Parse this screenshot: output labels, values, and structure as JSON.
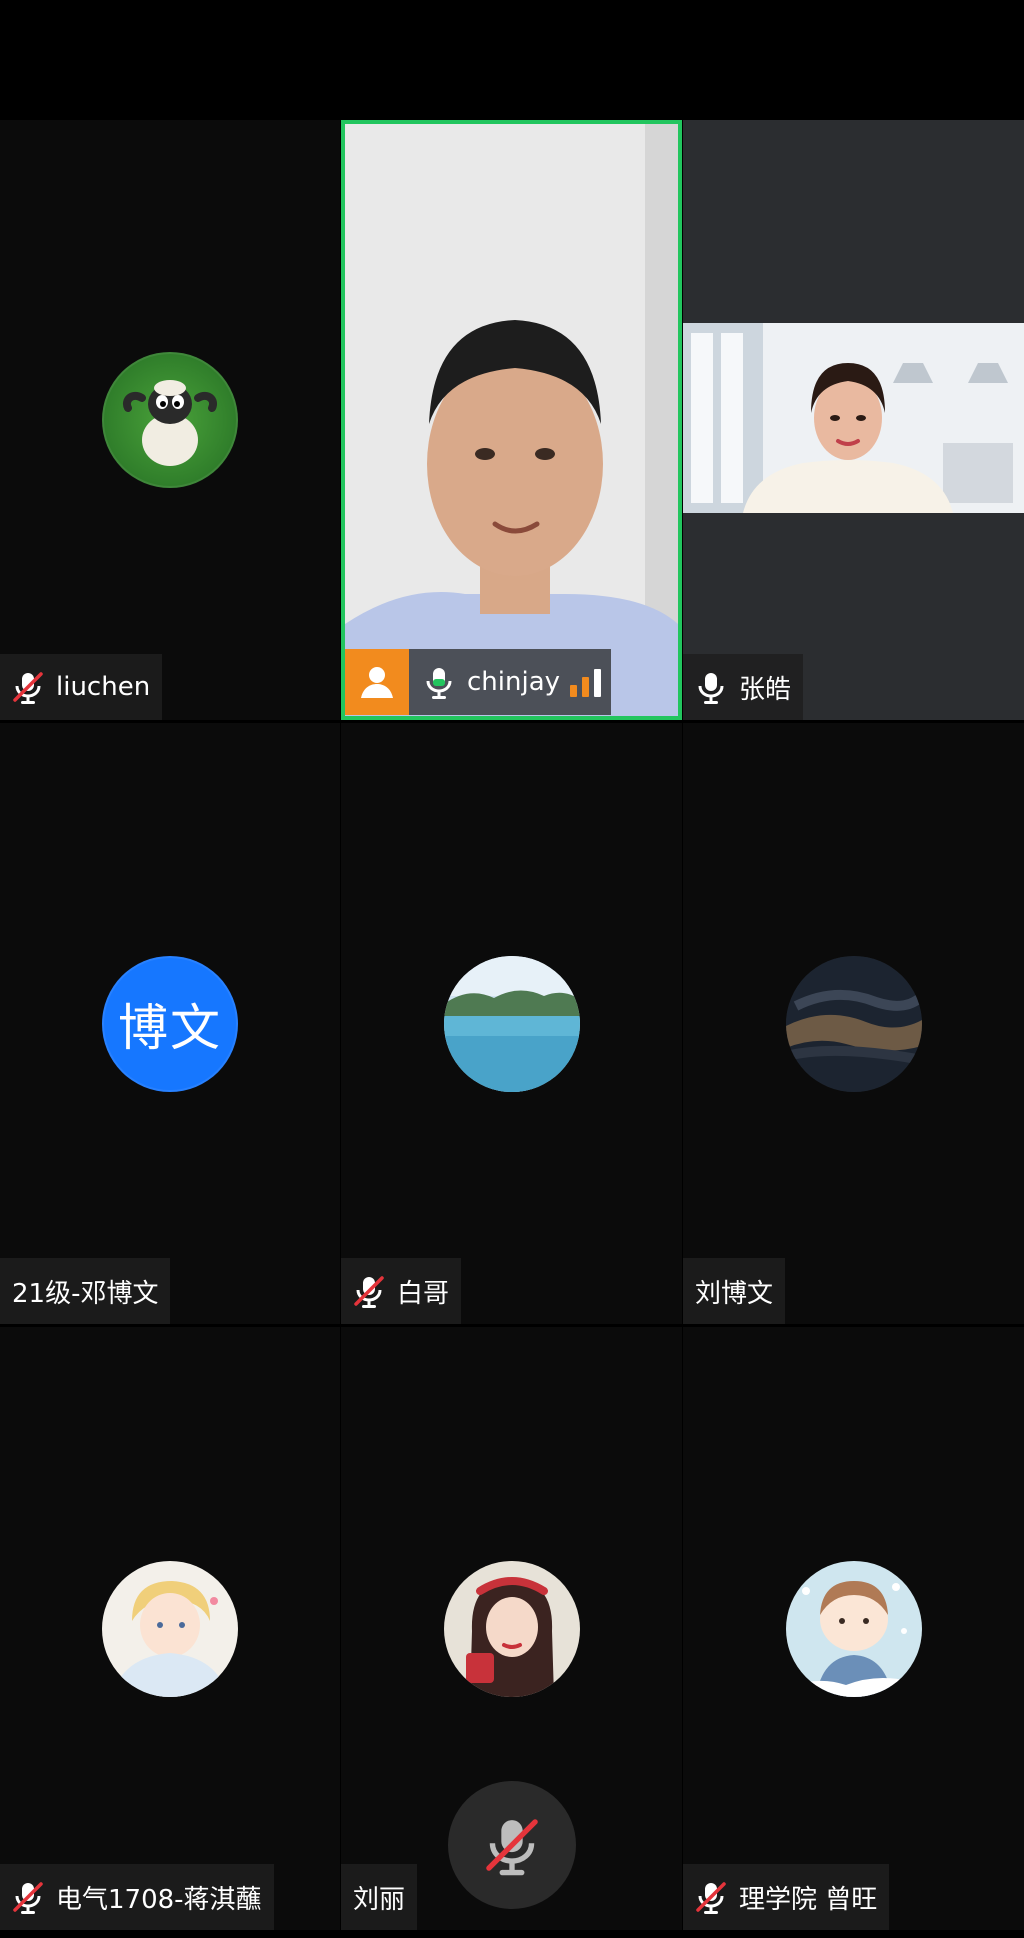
{
  "participants": [
    {
      "name": "liuchen",
      "muted": true,
      "avatar": "sheep-avatar"
    },
    {
      "name": "chinjay",
      "muted": false,
      "speaking": true,
      "video": "man-video"
    },
    {
      "name": "张皓",
      "muted": false,
      "video": "woman-video"
    },
    {
      "name": "21级-邓博文",
      "muted": false,
      "avatar_text": "博文"
    },
    {
      "name": "白哥",
      "muted": true,
      "avatar": "lake-avatar"
    },
    {
      "name": "刘博文",
      "muted": false,
      "avatar": "sky-avatar"
    },
    {
      "name": "电气1708-蒋淇蘸",
      "muted": true,
      "avatar": "anime-avatar"
    },
    {
      "name": "刘丽",
      "muted": false,
      "avatar": "girl-avatar"
    },
    {
      "name": "理学院 曾旺",
      "muted": true,
      "avatar": "cartoon-avatar"
    }
  ],
  "colors": {
    "active_border": "#22c55e",
    "badge": "#f28b1e",
    "blue_avatar": "#1677ff",
    "mic_green": "#22c55e",
    "mute_red": "#e5343b"
  }
}
